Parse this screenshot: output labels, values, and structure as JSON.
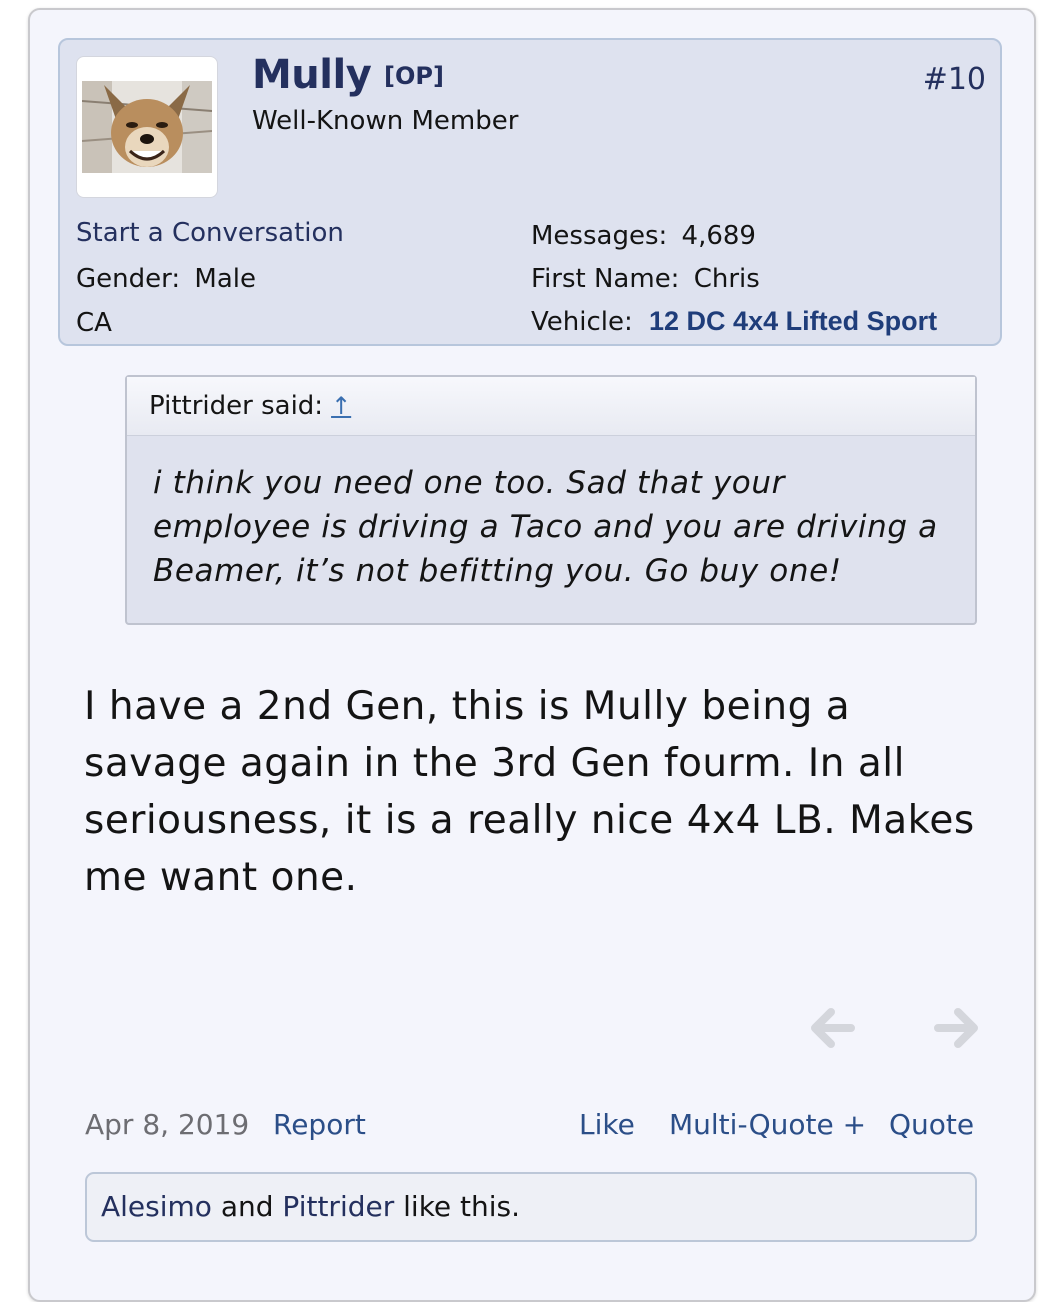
{
  "post": {
    "number": "#10",
    "user": {
      "name": "Mully",
      "tag": "[OP]",
      "title": "Well-Known Member",
      "start_conversation": "Start a Conversation",
      "gender_label": "Gender:",
      "gender": "Male",
      "location": "CA",
      "messages_label": "Messages:",
      "messages": "4,689",
      "first_name_label": "First Name:",
      "first_name": "Chris",
      "vehicle_label": "Vehicle:",
      "vehicle": "12 DC 4x4 Lifted Sport"
    },
    "quote": {
      "author": "Pittrider said:",
      "arrow": "↑",
      "text": "i think you need one too. Sad that your employee is driving a Taco and you are driving a Beamer, it’s not befitting you. Go buy one!"
    },
    "body": "I have a 2nd Gen, this is Mully being a savage again in the 3rd Gen fourm. In all seriousness, it is a really nice 4x4 LB. Makes me want one.",
    "footer": {
      "date": "Apr 8, 2019",
      "report": "Report",
      "like": "Like",
      "multi_quote": "Multi-Quote +",
      "quote": "Quote"
    },
    "likes": {
      "user1": "Alesimo",
      "and": " and ",
      "user2": "Pittrider",
      "suffix": " like this."
    }
  },
  "icons": [
    "arrow-left-icon",
    "arrow-right-icon"
  ],
  "colors": {
    "card_bg": "#f4f5fc",
    "panel_bg": "#dee2ef",
    "username": "#24305e",
    "link": "#2b4e88",
    "vehicle": "#1f3d7a"
  }
}
